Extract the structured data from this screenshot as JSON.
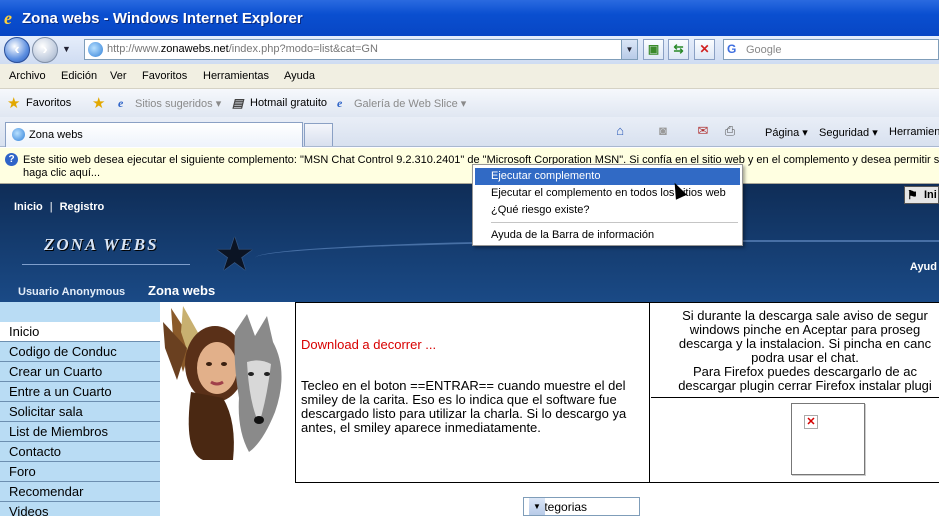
{
  "window": {
    "title": "Zona webs - Windows Internet Explorer"
  },
  "address": {
    "url_prefix": "http://www.",
    "url_domain": "zonawebs.net",
    "url_suffix": "/index.php?modo=list&cat=GN",
    "search_placeholder": "Google"
  },
  "menubar": [
    "Archivo",
    "Edición",
    "Ver",
    "Favoritos",
    "Herramientas",
    "Ayuda"
  ],
  "favorites": {
    "label": "Favoritos",
    "items": [
      "Sitios sugeridos ▾",
      "Hotmail gratuito",
      "Galería de Web Slice ▾"
    ]
  },
  "tabs": [
    {
      "label": "Zona webs"
    }
  ],
  "commandbar": {
    "page": "Página ▾",
    "security": "Seguridad ▾",
    "tools": "Herramien"
  },
  "infobar": {
    "line1": "Este sitio web desea ejecutar el siguiente complemento: \"MSN Chat Control 9.2.310.2401\" de \"Microsoft Corporation MSN\". Si confía en el sitio web y en el complemento y desea permitir su eje",
    "line2": "haga clic aquí..."
  },
  "context_menu": {
    "items": [
      "Ejecutar complemento",
      "Ejecutar el complemento en todos los sitios web",
      "¿Qué riesgo existe?",
      "Ayuda de la Barra de información"
    ]
  },
  "site": {
    "top_links": [
      "Inicio",
      "Registro"
    ],
    "logo": "ZONA WEBS",
    "ayuda": "Ayud",
    "inicio_button": "Ini",
    "user_label": "Usuario Anonymous",
    "site_label": "Zona webs",
    "sidebar": [
      "Inicio",
      "Codigo de Conduc",
      "Crear un Cuarto",
      "Entre a un Cuarto",
      "Solicitar sala",
      "List de Miembros",
      "Contacto",
      "Foro",
      "Recomendar",
      "Videos"
    ],
    "download_link": "Download a decorrer ...",
    "description": "Tecleo en el boton ==ENTRAR== cuando muestre el del smiley de la carita. Eso es lo indica que el software fue descargado listo para utilizar la charla. Si lo descargo ya antes, el smiley aparece inmediatamente.",
    "right_text": [
      "Si durante la descarga sale aviso de segur",
      "windows pinche en Aceptar para proseg",
      "descarga y la instalacion. Si pincha en canc",
      "podra usar el chat.",
      "Para Firefox puedes descargarlo de ac",
      "descargar plugin cerrar Firefox instalar plugi"
    ],
    "category_select": "Categorias"
  }
}
